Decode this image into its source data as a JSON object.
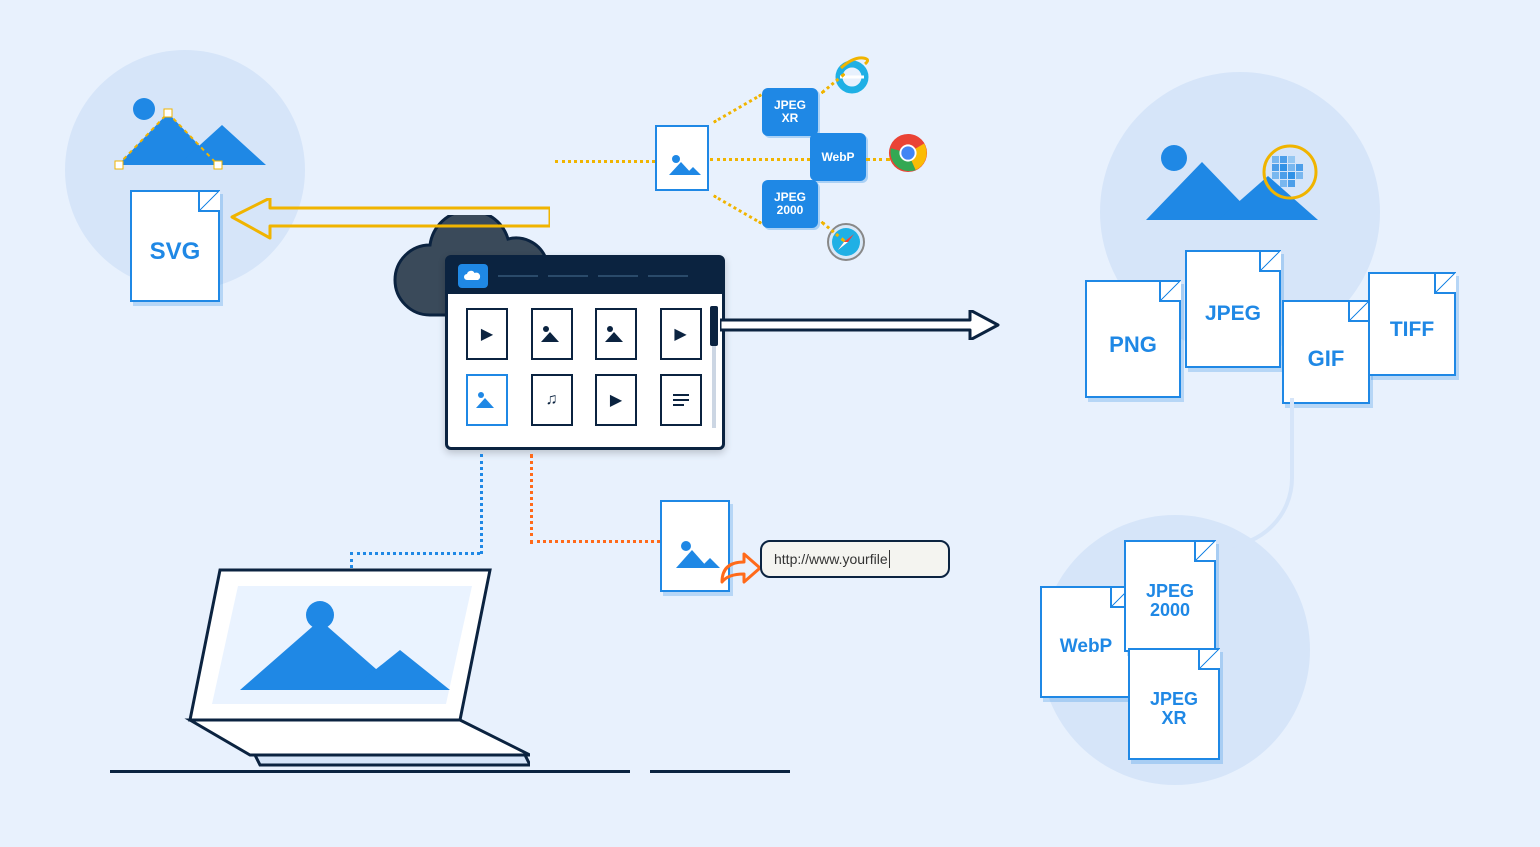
{
  "files": {
    "svg": "SVG",
    "png": "PNG",
    "jpeg": "JPEG",
    "gif": "GIF",
    "tiff": "TIFF",
    "webp": "WebP",
    "jpeg2000": "JPEG\n2000",
    "jpegxr": "JPEG\nXR"
  },
  "formats": {
    "jpegxr_t": "JPEG",
    "jpegxr_b": "XR",
    "webp": "WebP",
    "jpeg2000_t": "JPEG",
    "jpeg2000_b": "2000"
  },
  "url_field": "http://www.yourfile",
  "browsers": {
    "ie": "Internet Explorer",
    "chrome": "Chrome",
    "safari": "Safari"
  }
}
